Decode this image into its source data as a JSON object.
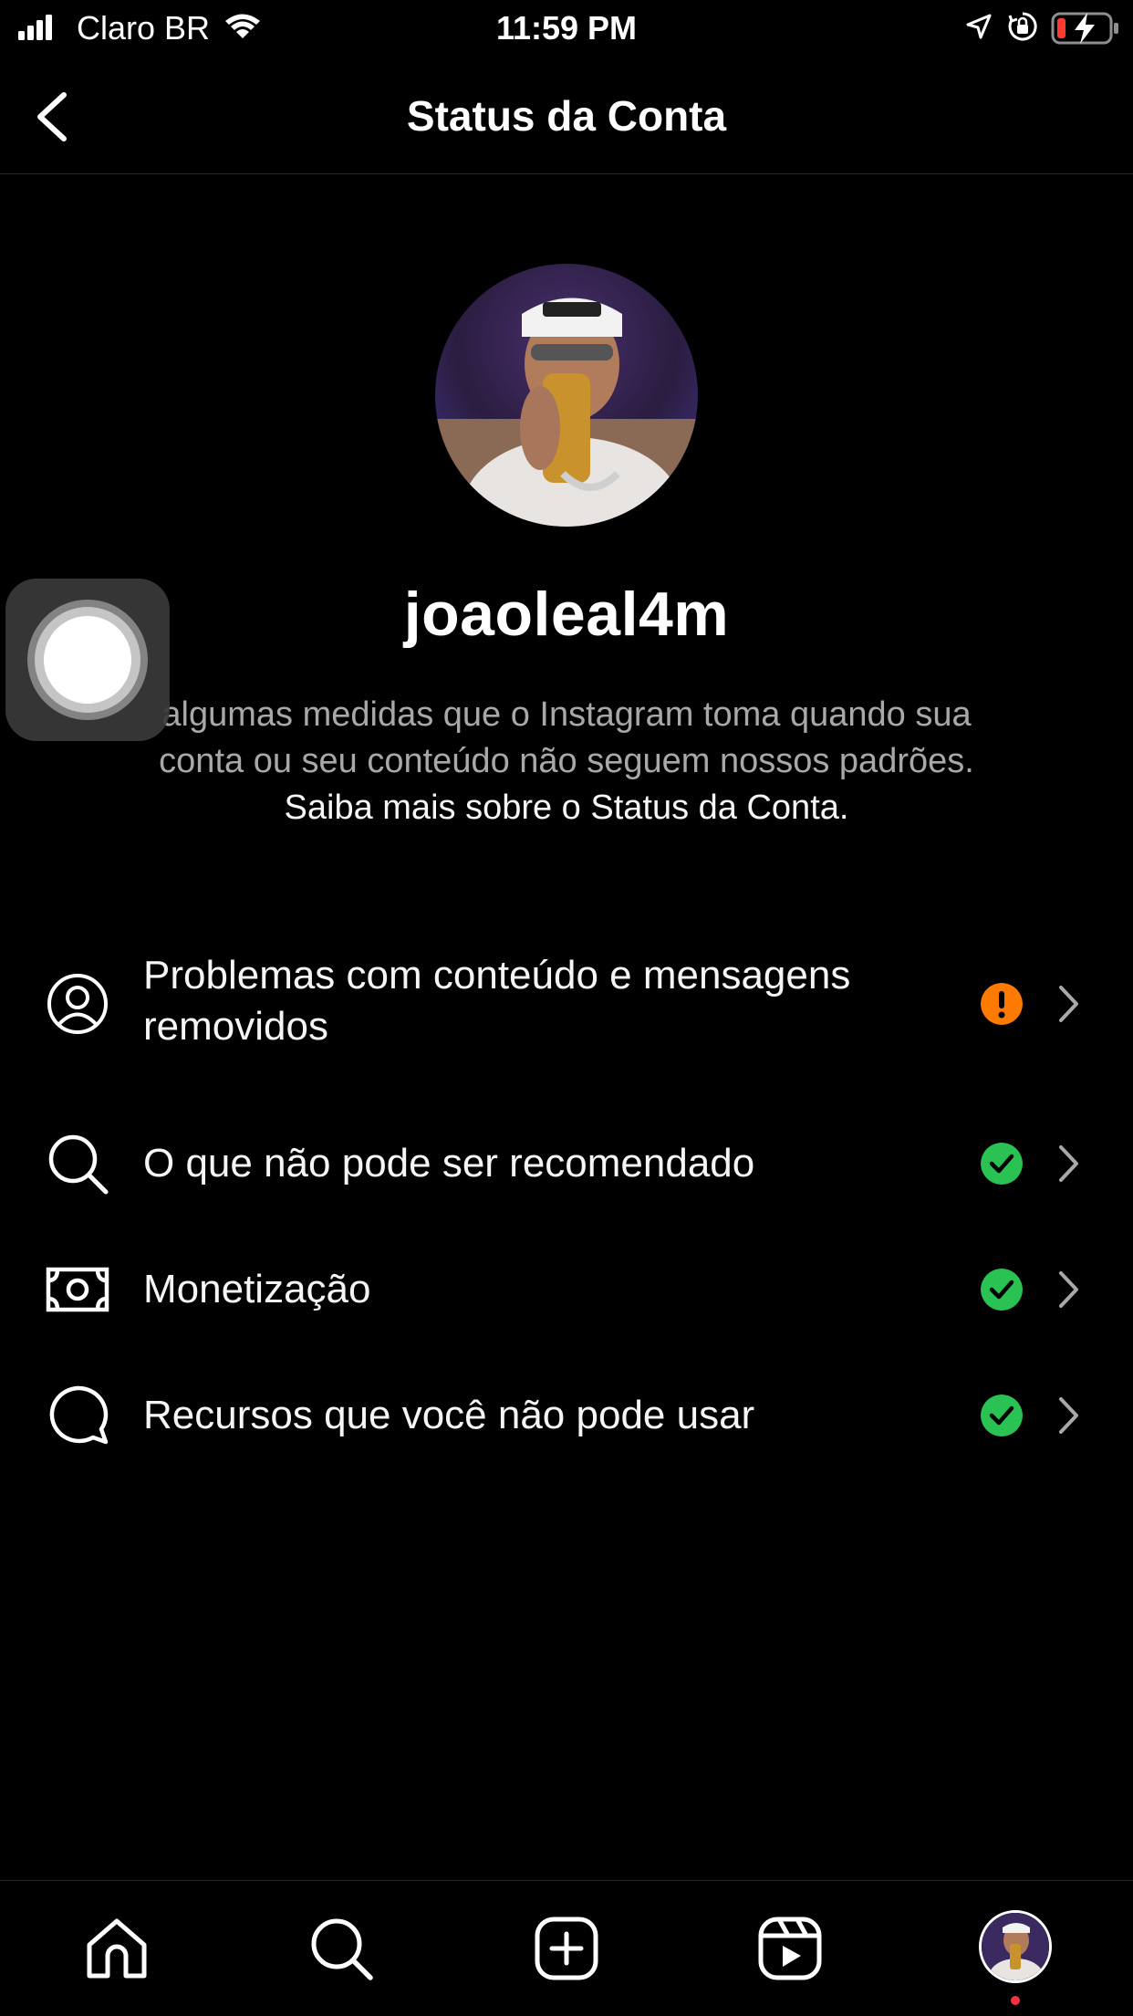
{
  "status_bar": {
    "carrier": "Claro BR",
    "time": "11:59 PM"
  },
  "header": {
    "title": "Status da Conta"
  },
  "profile": {
    "username": "joaoleal4m",
    "description": "algumas medidas que o Instagram toma quando sua conta ou seu conteúdo não seguem nossos padrões.",
    "learn_more": "Saiba mais sobre o Status da Conta."
  },
  "list": {
    "items": [
      {
        "label": "Problemas com conteúdo e mensagens removidos",
        "icon": "user-circle-icon",
        "status": "warning"
      },
      {
        "label": "O que não pode ser recomendado",
        "icon": "search-icon",
        "status": "ok"
      },
      {
        "label": "Monetização",
        "icon": "money-icon",
        "status": "ok"
      },
      {
        "label": "Recursos que você não pode usar",
        "icon": "speech-bubble-icon",
        "status": "ok"
      }
    ]
  },
  "colors": {
    "warning": "#ff7a00",
    "ok": "#2bc254",
    "background": "#000000",
    "notification": "#ff3040"
  },
  "tab_bar": {
    "tabs": [
      "home-icon",
      "search-icon",
      "create-icon",
      "reels-icon",
      "profile-avatar"
    ]
  }
}
